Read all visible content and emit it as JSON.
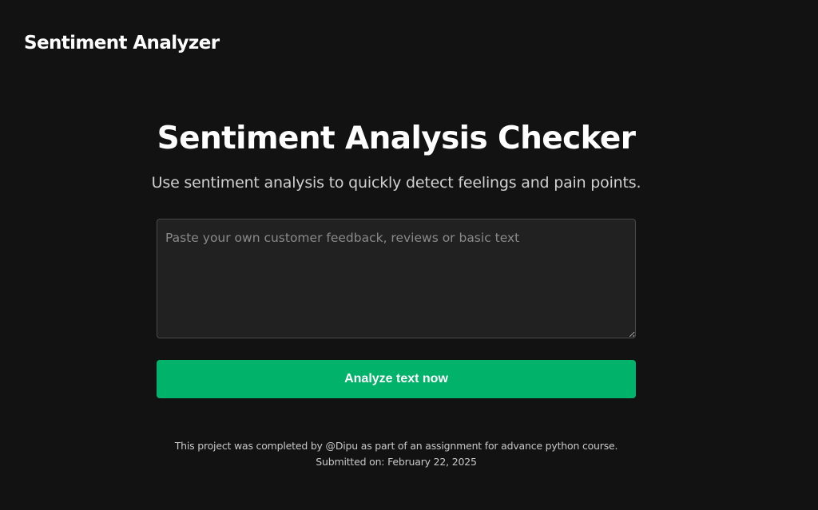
{
  "header": {
    "brand": "Sentiment Analyzer"
  },
  "hero": {
    "title": "Sentiment Analysis Checker",
    "subtitle": "Use sentiment analysis to quickly detect feelings and pain points."
  },
  "form": {
    "input_value": "",
    "input_placeholder": "Paste your own customer feedback, reviews or basic text",
    "button_label": "Analyze text now"
  },
  "footer": {
    "credit": "This project was completed by @Dipu as part of an assignment for advance python course.",
    "submitted": "Submitted on: February 22, 2025"
  },
  "colors": {
    "background": "#131213",
    "input_background": "#212121",
    "accent": "#00b26a",
    "text": "#ffffff",
    "muted_text": "#c8c8c8"
  }
}
